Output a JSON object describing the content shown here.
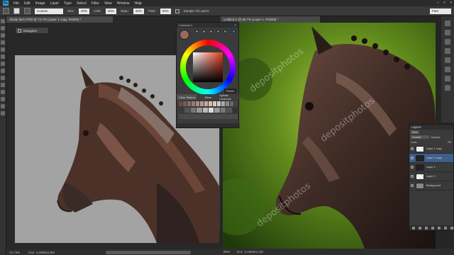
{
  "menubar": {
    "logo": "Ps",
    "items": [
      "File",
      "Edit",
      "Image",
      "Layer",
      "Type",
      "Select",
      "Filter",
      "View",
      "Window",
      "Help"
    ]
  },
  "options": {
    "mode_value": "Custom",
    "opacity_label": "Size:",
    "opacity_value": "20%",
    "flow_label": "Limit:",
    "flow_value": "20%",
    "strength_label": "Opac:",
    "strength_value": "20%",
    "tol_label": "Flow:",
    "tol_value": "20%",
    "sample_label": "Sample All Layers",
    "right_field": "Fate"
  },
  "left_doc": {
    "tab": "ohody farm.PSD @ 72.7% (Layer 1 copy, RGB/8) *",
    "navigator_label": "Navigator",
    "status_zoom": "72.73%",
    "status_doc": "Doc: 4,29M/16,9M"
  },
  "right_doc": {
    "tab": "Untitled-2 @ 88.7% (Layer 1, RGB/8) *",
    "status_zoom": "88%",
    "status_doc": "Doc: 2,18M/21,1M",
    "watermarks": [
      "depositphotos",
      "depositphotos",
      "depositphotos"
    ]
  },
  "color_wheel": {
    "title": "Coolorus 2",
    "hex": "726561",
    "tabs": [
      "Color Sliders",
      "Mixer",
      "Update Coolorus!"
    ],
    "accent": "#e43a1e",
    "strip1": [
      "#6b4a44",
      "#7d5a52",
      "#8a6a62",
      "#9a7a72",
      "#aa8a82",
      "#ba9a92",
      "#caaaa2",
      "#dabab2",
      "#e6c6be",
      "#ccc",
      "#aaa",
      "#888",
      "#666",
      "#444"
    ],
    "strip2": [
      "#3a3a3a",
      "#555",
      "#777",
      "#999",
      "#bbb",
      "#ddd",
      "#999",
      "#777",
      "#555",
      "#333"
    ]
  },
  "layers": {
    "title": "Layers",
    "kind_label": "Kind",
    "blend_mode": "Normal",
    "opacity_label": "Opacity:",
    "lock_label": "Lock:",
    "fill_label": "Fill:",
    "items": [
      {
        "name": "Layer 1 copy"
      },
      {
        "name": "Layer 1 copy"
      },
      {
        "name": "Layer 1"
      },
      {
        "name": "Layer 2"
      },
      {
        "name": "Background"
      }
    ]
  }
}
